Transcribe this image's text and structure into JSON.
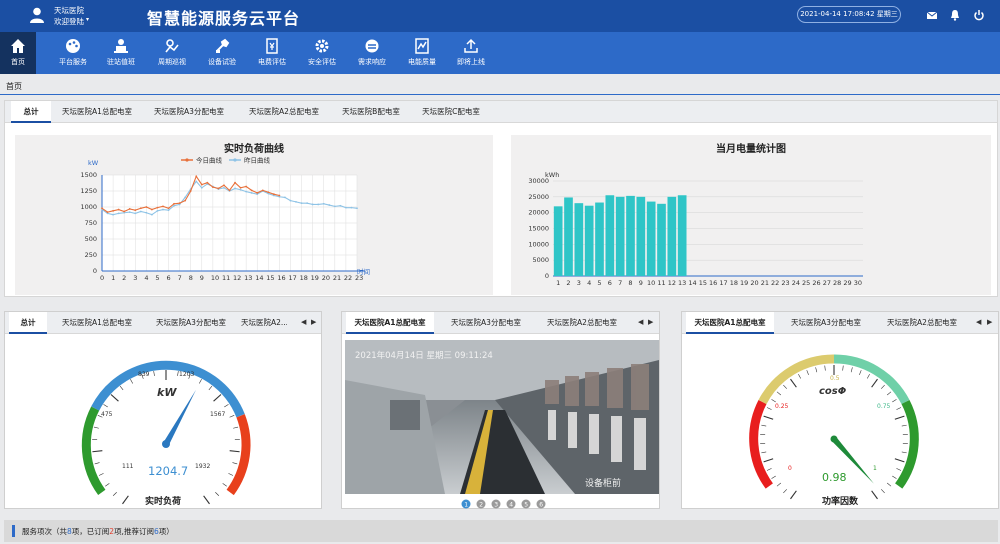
{
  "header": {
    "user_name": "天坛医院",
    "welcome": "欢迎登陆",
    "title": "智慧能源服务云平台",
    "datetime": "2021-04-14 17:08:42  星期三",
    "icons": [
      "mail-icon",
      "bell-icon",
      "power-icon"
    ]
  },
  "nav": {
    "items": [
      {
        "label": "首页",
        "icon": "home-icon",
        "active": true
      },
      {
        "label": "平台服务",
        "icon": "palette-icon"
      },
      {
        "label": "驻站值班",
        "icon": "duty-person-icon"
      },
      {
        "label": "周期巡视",
        "icon": "patrol-icon"
      },
      {
        "label": "设备试验",
        "icon": "tool-icon"
      },
      {
        "label": "电费评估",
        "icon": "bill-icon"
      },
      {
        "label": "安全评估",
        "icon": "gear-icon"
      },
      {
        "label": "需求响应",
        "icon": "sync-icon"
      },
      {
        "label": "电能质量",
        "icon": "quality-chart-icon"
      },
      {
        "label": "即将上线",
        "icon": "upload-icon"
      }
    ]
  },
  "breadcrumb": "首页",
  "main_tabs": [
    "总计",
    "天坛医院A1总配电室",
    "天坛医院A3分配电室",
    "天坛医院A2总配电室",
    "天坛医院B配电室",
    "天坛医院C配电室"
  ],
  "load_chart": {
    "title": "实时负荷曲线",
    "unit": "kW",
    "legend": [
      "今日曲线",
      "昨日曲线"
    ],
    "xlabel": "时间"
  },
  "energy_chart": {
    "title": "当月电量统计图",
    "unit": "kWh"
  },
  "gauge_tabs_1": [
    "总计",
    "天坛医院A1总配电室",
    "天坛医院A3分配电室",
    "天坛医院A2..."
  ],
  "gauge_tabs_2": [
    "天坛医院A1总配电室",
    "天坛医院A3分配电室",
    "天坛医院A2总配电室"
  ],
  "gauge_tabs_3": [
    "天坛医院A1总配电室",
    "天坛医院A3分配电室",
    "天坛医院A2总配电室"
  ],
  "load_gauge": {
    "unit": "kW",
    "value": 1204.7,
    "value_text": "1204.7",
    "caption": "实时负荷",
    "ticks": [
      "111",
      "475",
      "839",
      "1203",
      "1567",
      "1932"
    ]
  },
  "video": {
    "overlay_time": "2021年04月14日  星期三  09:11:24",
    "overlay_label": "设备柜前",
    "pages": [
      "1",
      "2",
      "3",
      "4",
      "5",
      "6"
    ],
    "current_page": 1
  },
  "pf_gauge": {
    "symbol": "cosΦ",
    "value": 0.98,
    "value_text": "0.98",
    "caption": "功率因数",
    "ticks": [
      "0",
      "0.25",
      "0.5",
      "0.75",
      "1"
    ]
  },
  "footer": {
    "prefix": "服务项次（共",
    "total": "8",
    "mid1": "项，已订阅",
    "subscribed": "2",
    "mid2": "项,推荐订阅",
    "recommended": "6",
    "suffix": "项）"
  },
  "colors": {
    "header": "#1b4fa3",
    "nav": "#2d6ac8",
    "today_line": "#e8703a",
    "yesterday_line": "#8ec3e6",
    "bar": "#2fc5c7",
    "gauge_blue": "#3d8fd1",
    "gauge_green": "#2e9a2e",
    "gauge_red": "#e8401c"
  },
  "chart_data": [
    {
      "type": "line",
      "title": "实时负荷曲线",
      "ylabel": "kW",
      "xlabel": "时间",
      "ylim": [
        0,
        1500
      ],
      "yticks": [
        0,
        250,
        500,
        750,
        1000,
        1250,
        1500
      ],
      "x": [
        0,
        0.5,
        1,
        1.5,
        2,
        2.5,
        3,
        3.5,
        4,
        4.5,
        5,
        5.5,
        6,
        6.5,
        7,
        7.5,
        8,
        8.5,
        9,
        9.5,
        10,
        10.5,
        11,
        11.5,
        12,
        12.5,
        13,
        13.5,
        14,
        14.5,
        15,
        15.5,
        16,
        16.5,
        17,
        17.5,
        18,
        18.5,
        19,
        19.5,
        20,
        20.5,
        21,
        21.5,
        22,
        22.5,
        23
      ],
      "series": [
        {
          "name": "今日曲线",
          "values": [
            980,
            920,
            940,
            960,
            930,
            970,
            950,
            980,
            1000,
            960,
            990,
            1010,
            980,
            1050,
            1060,
            1100,
            1250,
            1480,
            1350,
            1380,
            1310,
            1290,
            1340,
            1260,
            1380,
            1300,
            1320,
            1260,
            1220,
            1260,
            1230,
            1200,
            1180
          ]
        },
        {
          "name": "昨日曲线",
          "values": [
            960,
            900,
            880,
            900,
            910,
            920,
            900,
            930,
            910,
            880,
            940,
            960,
            950,
            1020,
            1040,
            1150,
            1280,
            1400,
            1300,
            1360,
            1320,
            1280,
            1300,
            1250,
            1290,
            1270,
            1240,
            1220,
            1200,
            1250,
            1210,
            1180,
            1160,
            1150,
            1100,
            1080,
            1060,
            1060,
            1040,
            1040,
            1050,
            1030,
            1010,
            1020,
            990,
            990,
            980
          ]
        }
      ],
      "legend_position": "top"
    },
    {
      "type": "bar",
      "title": "当月电量统计图",
      "ylabel": "kWh",
      "ylim": [
        0,
        30000
      ],
      "yticks": [
        0,
        5000,
        10000,
        15000,
        20000,
        25000,
        30000
      ],
      "categories": [
        "1",
        "2",
        "3",
        "4",
        "5",
        "6",
        "7",
        "8",
        "9",
        "10",
        "11",
        "12",
        "13",
        "14",
        "15",
        "16",
        "17",
        "18",
        "19",
        "20",
        "21",
        "22",
        "23",
        "24",
        "25",
        "26",
        "27",
        "28",
        "29",
        "30"
      ],
      "values": [
        22000,
        24800,
        23000,
        22200,
        23200,
        25500,
        25000,
        25300,
        25000,
        23500,
        22800,
        25000,
        25500,
        null,
        null,
        null,
        null,
        null,
        null,
        null,
        null,
        null,
        null,
        null,
        null,
        null,
        null,
        null,
        null,
        null
      ]
    }
  ]
}
